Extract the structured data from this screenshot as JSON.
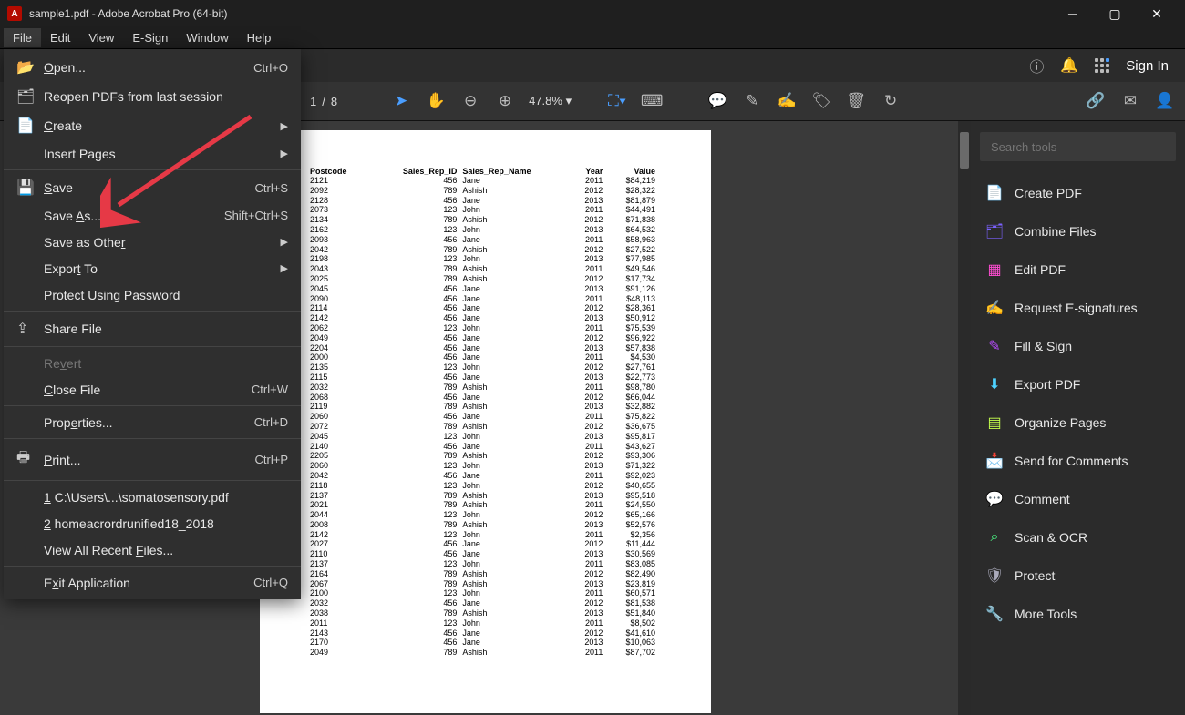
{
  "window": {
    "title": "sample1.pdf - Adobe Acrobat Pro (64-bit)"
  },
  "menubar": [
    "File",
    "Edit",
    "View",
    "E-Sign",
    "Window",
    "Help"
  ],
  "topbar": {
    "signin": "Sign In"
  },
  "toolbar": {
    "page_current": "1",
    "page_sep": "/",
    "page_total": "8",
    "zoom": "47.8%"
  },
  "file_menu": {
    "open": "Open...",
    "open_sc": "Ctrl+O",
    "reopen": "Reopen PDFs from last session",
    "create": "Create",
    "insert": "Insert Pages",
    "save": "Save",
    "save_sc": "Ctrl+S",
    "saveas": "Save As...",
    "saveas_sc": "Shift+Ctrl+S",
    "saveother": "Save as Other",
    "export": "Export To",
    "protect": "Protect Using Password",
    "share": "Share File",
    "revert": "Revert",
    "close": "Close File",
    "close_sc": "Ctrl+W",
    "props": "Properties...",
    "props_sc": "Ctrl+D",
    "print": "Print...",
    "print_sc": "Ctrl+P",
    "recent1": "1 C:\\Users\\...\\somatosensory.pdf",
    "recent2": "2 homeacrordrunified18_2018",
    "viewall": "View All Recent Files...",
    "exit": "Exit Application",
    "exit_sc": "Ctrl+Q"
  },
  "sidebar": {
    "search_ph": "Search tools",
    "tools": [
      {
        "label": "Create PDF",
        "color": "#ff4d6d"
      },
      {
        "label": "Combine Files",
        "color": "#7b61ff"
      },
      {
        "label": "Edit PDF",
        "color": "#ff4dd2"
      },
      {
        "label": "Request E-signatures",
        "color": "#b84dff"
      },
      {
        "label": "Fill & Sign",
        "color": "#b84dff"
      },
      {
        "label": "Export PDF",
        "color": "#4dd2ff"
      },
      {
        "label": "Organize Pages",
        "color": "#c4ff4d"
      },
      {
        "label": "Send for Comments",
        "color": "#ffd24d"
      },
      {
        "label": "Comment",
        "color": "#ffd24d"
      },
      {
        "label": "Scan & OCR",
        "color": "#4dff88"
      },
      {
        "label": "Protect",
        "color": "#aab"
      },
      {
        "label": "More Tools",
        "color": "#aab"
      }
    ]
  },
  "doc": {
    "headers": [
      "Postcode",
      "Sales_Rep_ID",
      "Sales_Rep_Name",
      "Year",
      "Value"
    ],
    "rows": [
      [
        "2121",
        "456",
        "Jane",
        "2011",
        "$84,219"
      ],
      [
        "2092",
        "789",
        "Ashish",
        "2012",
        "$28,322"
      ],
      [
        "2128",
        "456",
        "Jane",
        "2013",
        "$81,879"
      ],
      [
        "2073",
        "123",
        "John",
        "2011",
        "$44,491"
      ],
      [
        "2134",
        "789",
        "Ashish",
        "2012",
        "$71,838"
      ],
      [
        "2162",
        "123",
        "John",
        "2013",
        "$64,532"
      ],
      [
        "2093",
        "456",
        "Jane",
        "2011",
        "$58,963"
      ],
      [
        "2042",
        "789",
        "Ashish",
        "2012",
        "$27,522"
      ],
      [
        "2198",
        "123",
        "John",
        "2013",
        "$77,985"
      ],
      [
        "2043",
        "789",
        "Ashish",
        "2011",
        "$49,546"
      ],
      [
        "2025",
        "789",
        "Ashish",
        "2012",
        "$17,734"
      ],
      [
        "2045",
        "456",
        "Jane",
        "2013",
        "$91,126"
      ],
      [
        "2090",
        "456",
        "Jane",
        "2011",
        "$48,113"
      ],
      [
        "2114",
        "456",
        "Jane",
        "2012",
        "$28,361"
      ],
      [
        "2142",
        "456",
        "Jane",
        "2013",
        "$50,912"
      ],
      [
        "2062",
        "123",
        "John",
        "2011",
        "$75,539"
      ],
      [
        "2049",
        "456",
        "Jane",
        "2012",
        "$96,922"
      ],
      [
        "2204",
        "456",
        "Jane",
        "2013",
        "$57,838"
      ],
      [
        "2000",
        "456",
        "Jane",
        "2011",
        "$4,530"
      ],
      [
        "2135",
        "123",
        "John",
        "2012",
        "$27,761"
      ],
      [
        "2115",
        "456",
        "Jane",
        "2013",
        "$22,773"
      ],
      [
        "2032",
        "789",
        "Ashish",
        "2011",
        "$98,780"
      ],
      [
        "2068",
        "456",
        "Jane",
        "2012",
        "$66,044"
      ],
      [
        "2119",
        "789",
        "Ashish",
        "2013",
        "$32,882"
      ],
      [
        "2060",
        "456",
        "Jane",
        "2011",
        "$75,822"
      ],
      [
        "2072",
        "789",
        "Ashish",
        "2012",
        "$36,675"
      ],
      [
        "2045",
        "123",
        "John",
        "2013",
        "$95,817"
      ],
      [
        "2140",
        "456",
        "Jane",
        "2011",
        "$43,627"
      ],
      [
        "2205",
        "789",
        "Ashish",
        "2012",
        "$93,306"
      ],
      [
        "2060",
        "123",
        "John",
        "2013",
        "$71,322"
      ],
      [
        "2042",
        "456",
        "Jane",
        "2011",
        "$92,023"
      ],
      [
        "2118",
        "123",
        "John",
        "2012",
        "$40,655"
      ],
      [
        "2137",
        "789",
        "Ashish",
        "2013",
        "$95,518"
      ],
      [
        "2021",
        "789",
        "Ashish",
        "2011",
        "$24,550"
      ],
      [
        "2044",
        "123",
        "John",
        "2012",
        "$65,166"
      ],
      [
        "2008",
        "789",
        "Ashish",
        "2013",
        "$52,576"
      ],
      [
        "2142",
        "123",
        "John",
        "2011",
        "$2,356"
      ],
      [
        "2027",
        "456",
        "Jane",
        "2012",
        "$11,444"
      ],
      [
        "2110",
        "456",
        "Jane",
        "2013",
        "$30,569"
      ],
      [
        "2137",
        "123",
        "John",
        "2011",
        "$83,085"
      ],
      [
        "2164",
        "789",
        "Ashish",
        "2012",
        "$82,490"
      ],
      [
        "2067",
        "789",
        "Ashish",
        "2013",
        "$23,819"
      ],
      [
        "2100",
        "123",
        "John",
        "2011",
        "$60,571"
      ],
      [
        "2032",
        "456",
        "Jane",
        "2012",
        "$81,538"
      ],
      [
        "2038",
        "789",
        "Ashish",
        "2013",
        "$51,840"
      ],
      [
        "2011",
        "123",
        "John",
        "2011",
        "$8,502"
      ],
      [
        "2143",
        "456",
        "Jane",
        "2012",
        "$41,610"
      ],
      [
        "2170",
        "456",
        "Jane",
        "2013",
        "$10,063"
      ],
      [
        "2049",
        "789",
        "Ashish",
        "2011",
        "$87,702"
      ]
    ]
  }
}
